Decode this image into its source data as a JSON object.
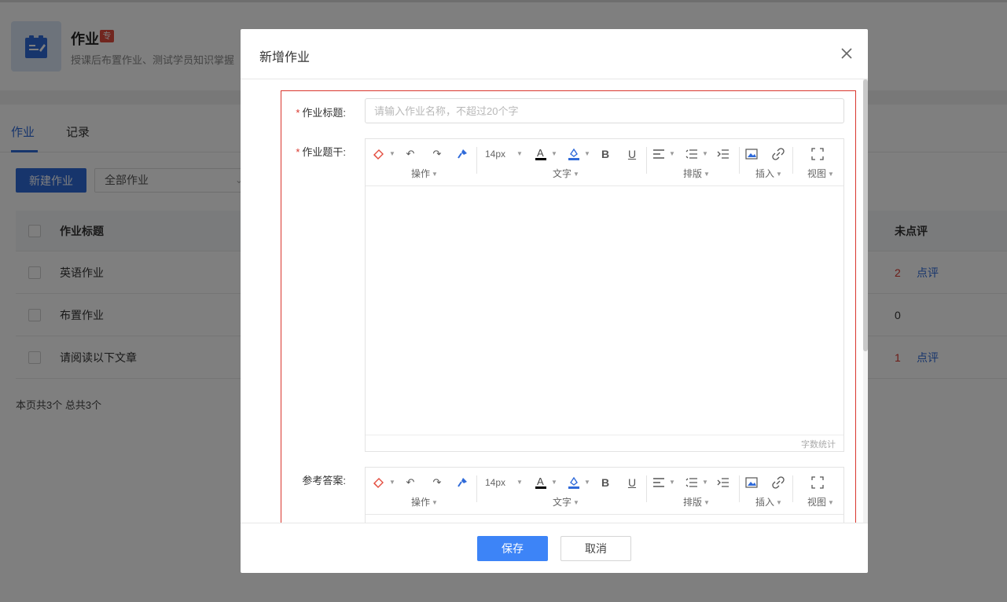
{
  "app": {
    "title": "作业",
    "badge": "专",
    "description": "授课后布置作业、测试学员知识掌握"
  },
  "tabs": [
    {
      "label": "作业",
      "active": true
    },
    {
      "label": "记录",
      "active": false
    }
  ],
  "toolbar": {
    "new_button": "新建作业",
    "filter_value": "全部作业"
  },
  "table": {
    "headers": {
      "title": "作业标题",
      "unreviewed": "未点评"
    },
    "rows": [
      {
        "title": "英语作业",
        "unreviewed": "2",
        "action": "点评"
      },
      {
        "title": "布置作业",
        "unreviewed": "0",
        "action": ""
      },
      {
        "title": "请阅读以下文章",
        "unreviewed": "1",
        "action": "点评"
      }
    ],
    "footer": "本页共3个 总共3个"
  },
  "modal": {
    "title": "新增作业",
    "fields": {
      "title_label": "作业标题:",
      "title_placeholder": "请输入作业名称，不超过20个字",
      "stem_label": "作业题干:",
      "answer_label": "参考答案:"
    },
    "editor": {
      "font_size": "14px",
      "groups": [
        "操作",
        "文字",
        "排版",
        "插入",
        "视图"
      ],
      "word_count": "字数统计"
    },
    "save_label": "保存",
    "cancel_label": "取消"
  },
  "colors": {
    "accent": "#2f6ad9",
    "save": "#3d84f7",
    "required": "#d9362d",
    "highlight_border": "#d9362d"
  }
}
